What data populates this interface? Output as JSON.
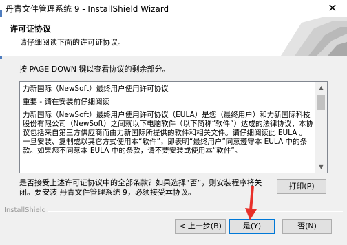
{
  "window": {
    "title": "丹青文件管理系统 9 - InstallShield Wizard",
    "close_glyph": "✕"
  },
  "header": {
    "title": "许可证协议",
    "subtitle": "请仔细阅读下面的许可证协议。"
  },
  "instruction": "按 PAGE DOWN 键以查看协议的剩余部分。",
  "license": {
    "paragraphs": [
      "力新国际（NewSoft）最终用户使用许可协议",
      "重要 - 请在安装前仔细阅读",
      "力新国际（NewSoft）最终用户使用许可协议（EULA）是您（最终用户）和力新国际科技股份有限公司（NewSoft）之间就以下电脑软件（以下简称“软件”）达成的法律协议，本协议包括来自第三方供应商而由力新国际所提供的软件和相关文件。请仔细阅读此 EULA 。一旦安装、复制或以其它方式使用本“软件”，即表明“最终用户”同意遵守本 EULA 中的条款。如果您不同意本 EULA 中的条款，请不要安装或使用本“软件”。"
    ]
  },
  "question": "是否接受上述许可证协议中的全部条款？如果选择“否”，则安装程序将关闭。要安装 丹青文件管理系统 9，必须接受本协议。",
  "buttons": {
    "print": "打印(P)",
    "back": "< 上一步(B)",
    "yes": "是(Y)",
    "no": "否(N)"
  },
  "footer_brand": "InstallShield",
  "colors": {
    "focus_border": "#0078d7",
    "annotation_arrow": "#e8302a"
  }
}
